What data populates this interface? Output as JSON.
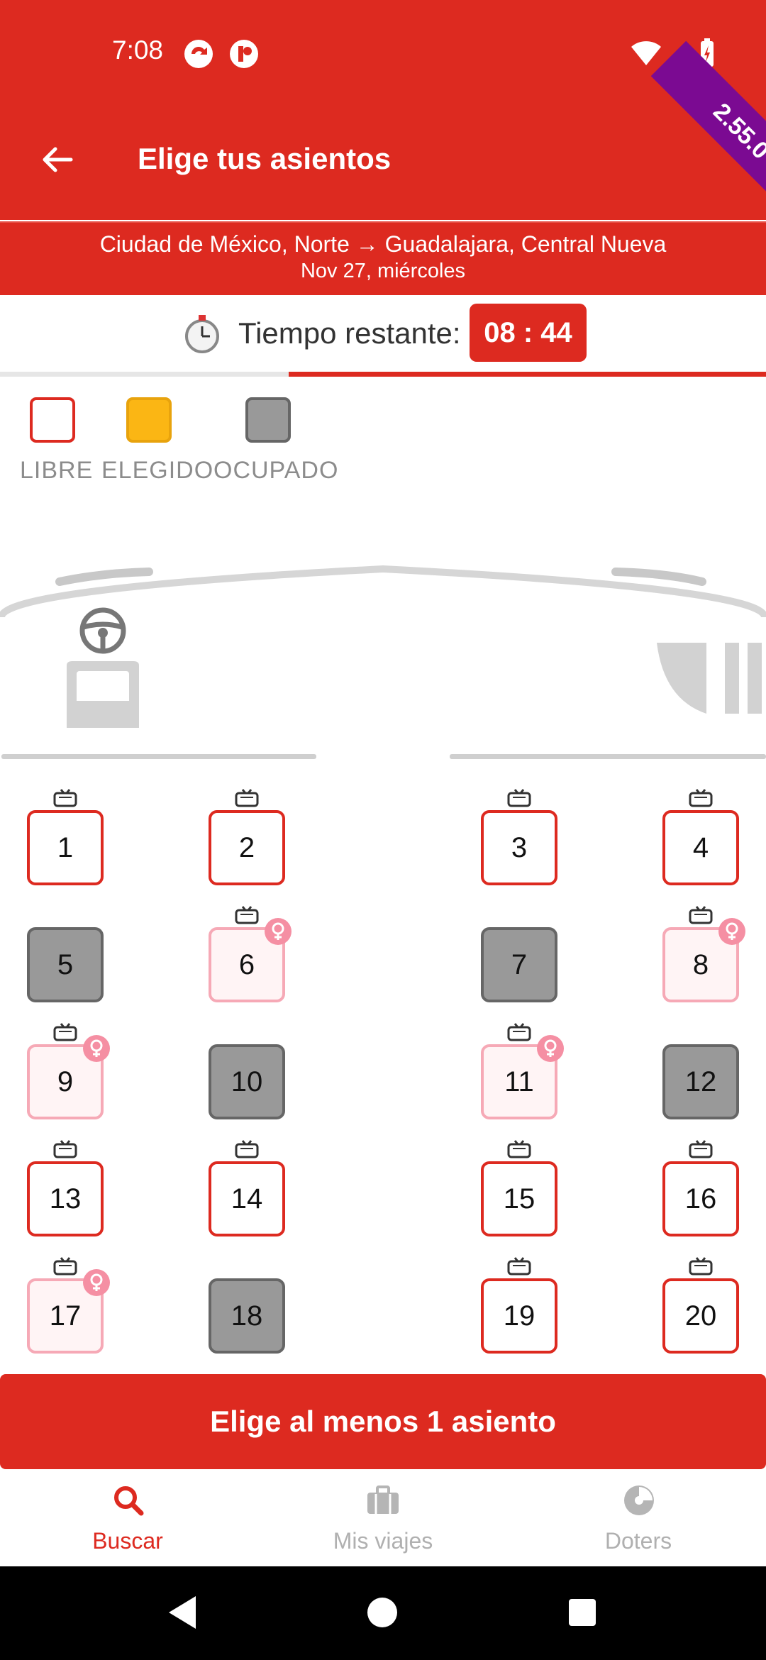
{
  "status_bar": {
    "time": "7:08"
  },
  "header": {
    "title": "Elige tus asientos",
    "version_badge": "2.55.0"
  },
  "route": {
    "line": "Ciudad de México, Norte → Guadalajara, Central Nueva",
    "date": "Nov 27, miércoles"
  },
  "timer": {
    "label": "Tiempo restante:",
    "value": "08 : 44",
    "progress_remaining": 0.62
  },
  "legend": [
    {
      "label": "LIBRE",
      "status": "libre"
    },
    {
      "label": "ELEGIDO",
      "status": "elegido"
    },
    {
      "label": "OCUPADO",
      "status": "ocupado"
    }
  ],
  "colors": {
    "brand": "#dd2a20",
    "selected": "#fbb614",
    "occupied": "#999999",
    "female": "#f58fa3",
    "version": "#7b0a92"
  },
  "seats": [
    {
      "number": "1",
      "status": "libre",
      "tv": true,
      "female": false
    },
    {
      "number": "2",
      "status": "libre",
      "tv": true,
      "female": false
    },
    {
      "number": "3",
      "status": "libre",
      "tv": true,
      "female": false
    },
    {
      "number": "4",
      "status": "libre",
      "tv": true,
      "female": false
    },
    {
      "number": "5",
      "status": "ocupado",
      "tv": false,
      "female": false
    },
    {
      "number": "6",
      "status": "mujer",
      "tv": true,
      "female": true
    },
    {
      "number": "7",
      "status": "ocupado",
      "tv": false,
      "female": false
    },
    {
      "number": "8",
      "status": "mujer",
      "tv": true,
      "female": true
    },
    {
      "number": "9",
      "status": "mujer",
      "tv": true,
      "female": true
    },
    {
      "number": "10",
      "status": "ocupado",
      "tv": false,
      "female": false
    },
    {
      "number": "11",
      "status": "mujer",
      "tv": true,
      "female": true
    },
    {
      "number": "12",
      "status": "ocupado",
      "tv": false,
      "female": false
    },
    {
      "number": "13",
      "status": "libre",
      "tv": true,
      "female": false
    },
    {
      "number": "14",
      "status": "libre",
      "tv": true,
      "female": false
    },
    {
      "number": "15",
      "status": "libre",
      "tv": true,
      "female": false
    },
    {
      "number": "16",
      "status": "libre",
      "tv": true,
      "female": false
    },
    {
      "number": "17",
      "status": "mujer",
      "tv": true,
      "female": true
    },
    {
      "number": "18",
      "status": "ocupado",
      "tv": false,
      "female": false
    },
    {
      "number": "19",
      "status": "libre",
      "tv": true,
      "female": false
    },
    {
      "number": "20",
      "status": "libre",
      "tv": true,
      "female": false
    }
  ],
  "cta": {
    "label": "Elige al menos 1 asiento"
  },
  "bottom_nav": [
    {
      "label": "Buscar",
      "icon": "search-icon",
      "active": true
    },
    {
      "label": "Mis viajes",
      "icon": "suitcase-icon",
      "active": false
    },
    {
      "label": "Doters",
      "icon": "doters-icon",
      "active": false
    }
  ]
}
